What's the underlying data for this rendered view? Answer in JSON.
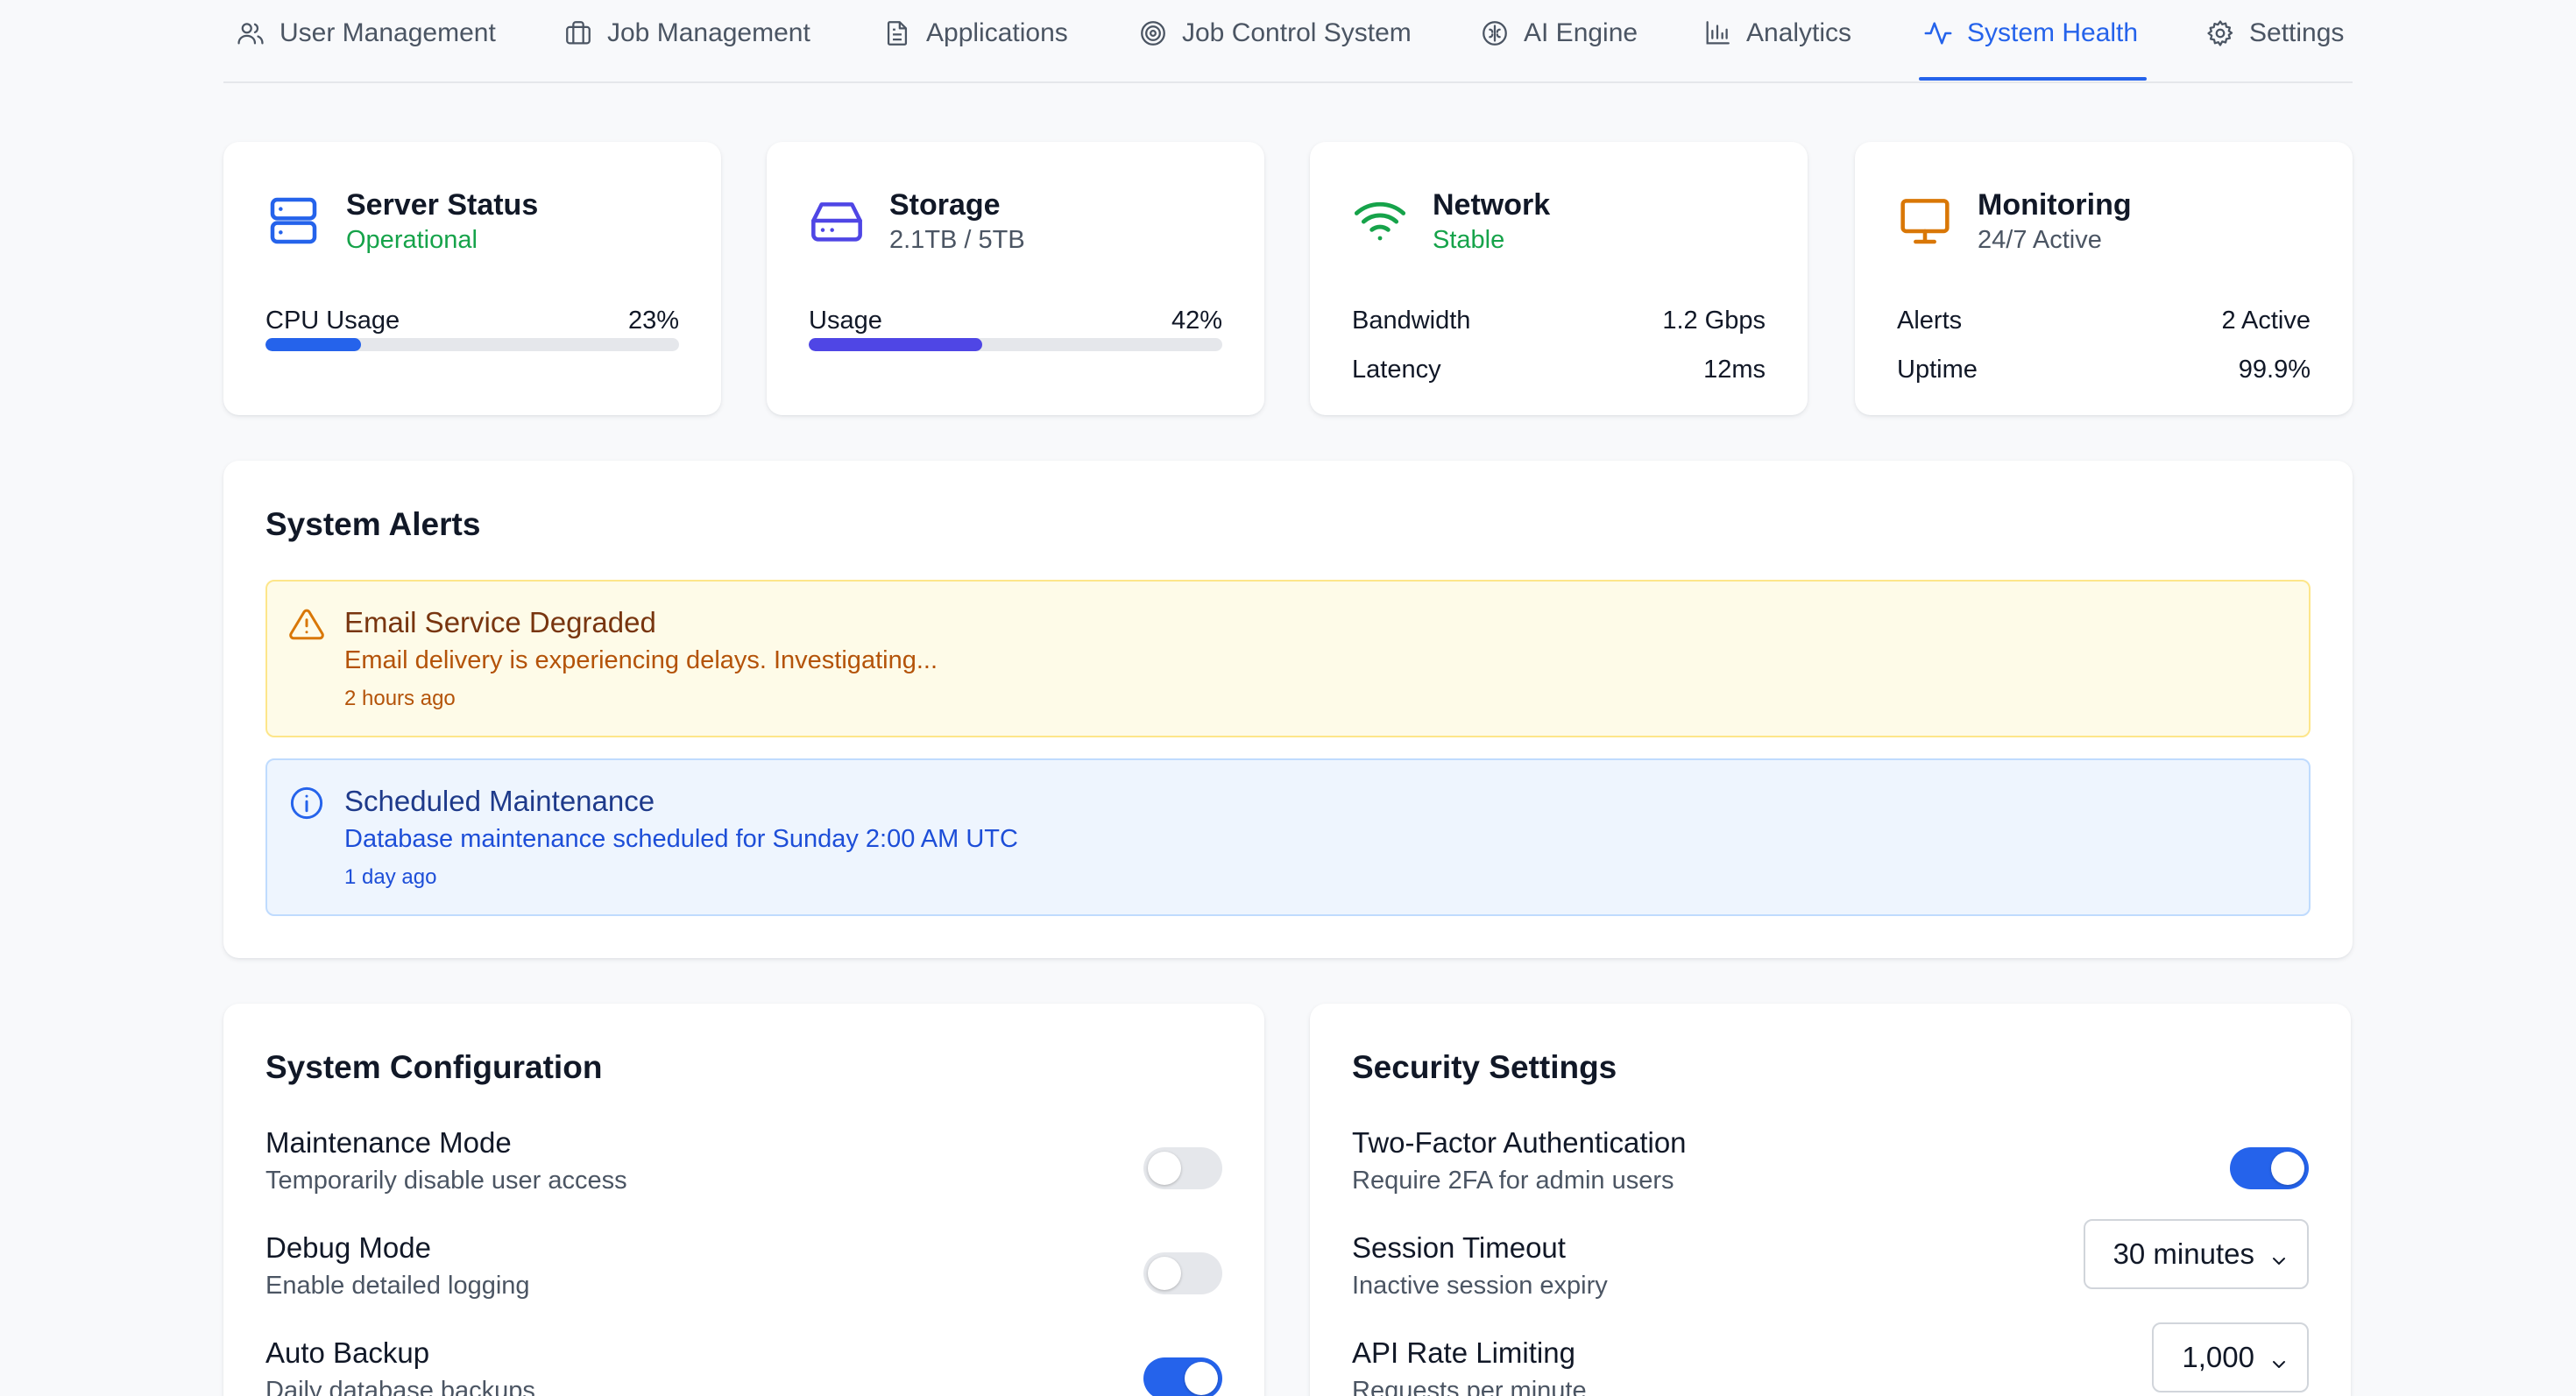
{
  "nav": {
    "items": [
      {
        "label": "User Management",
        "icon": "users-icon"
      },
      {
        "label": "Job Management",
        "icon": "briefcase-icon"
      },
      {
        "label": "Applications",
        "icon": "document-icon"
      },
      {
        "label": "Job Control System",
        "icon": "target-icon"
      },
      {
        "label": "AI Engine",
        "icon": "brain-icon"
      },
      {
        "label": "Analytics",
        "icon": "bar-chart-icon"
      },
      {
        "label": "System Health",
        "icon": "activity-icon",
        "active": true
      },
      {
        "label": "Settings",
        "icon": "gear-icon"
      }
    ]
  },
  "stats": {
    "server": {
      "title": "Server Status",
      "status": "Operational",
      "metric_label": "CPU Usage",
      "metric_value": "23%",
      "progress": 0.23,
      "color": "#2563eb"
    },
    "storage": {
      "title": "Storage",
      "status": "2.1TB / 5TB",
      "metric_label": "Usage",
      "metric_value": "42%",
      "progress": 0.42,
      "color": "#4f46e5"
    },
    "network": {
      "title": "Network",
      "status": "Stable",
      "rows": [
        {
          "label": "Bandwidth",
          "value": "1.2 Gbps"
        },
        {
          "label": "Latency",
          "value": "12ms"
        }
      ],
      "color": "#16a34a"
    },
    "monitoring": {
      "title": "Monitoring",
      "status": "24/7 Active",
      "rows": [
        {
          "label": "Alerts",
          "value": "2 Active"
        },
        {
          "label": "Uptime",
          "value": "99.9%"
        }
      ],
      "color": "#d97706"
    }
  },
  "alerts": {
    "title": "System Alerts",
    "items": [
      {
        "type": "warning",
        "icon": "warning-triangle-icon",
        "title": "Email Service Degraded",
        "message": "Email delivery is experiencing delays. Investigating...",
        "time": "2 hours ago"
      },
      {
        "type": "info",
        "icon": "info-circle-icon",
        "title": "Scheduled Maintenance",
        "message": "Database maintenance scheduled for Sunday 2:00 AM UTC",
        "time": "1 day ago"
      }
    ]
  },
  "system_config": {
    "title": "System Configuration",
    "settings": [
      {
        "label": "Maintenance Mode",
        "desc": "Temporarily disable user access",
        "enabled": false
      },
      {
        "label": "Debug Mode",
        "desc": "Enable detailed logging",
        "enabled": false
      },
      {
        "label": "Auto Backup",
        "desc": "Daily database backups",
        "enabled": true
      }
    ]
  },
  "security": {
    "title": "Security Settings",
    "settings": [
      {
        "label": "Two-Factor Authentication",
        "desc": "Require 2FA for admin users",
        "enabled": true
      },
      {
        "label": "Session Timeout",
        "desc": "Inactive session expiry",
        "selected": "30 minutes"
      },
      {
        "label": "API Rate Limiting",
        "desc": "Requests per minute",
        "selected": "1,000"
      }
    ]
  }
}
